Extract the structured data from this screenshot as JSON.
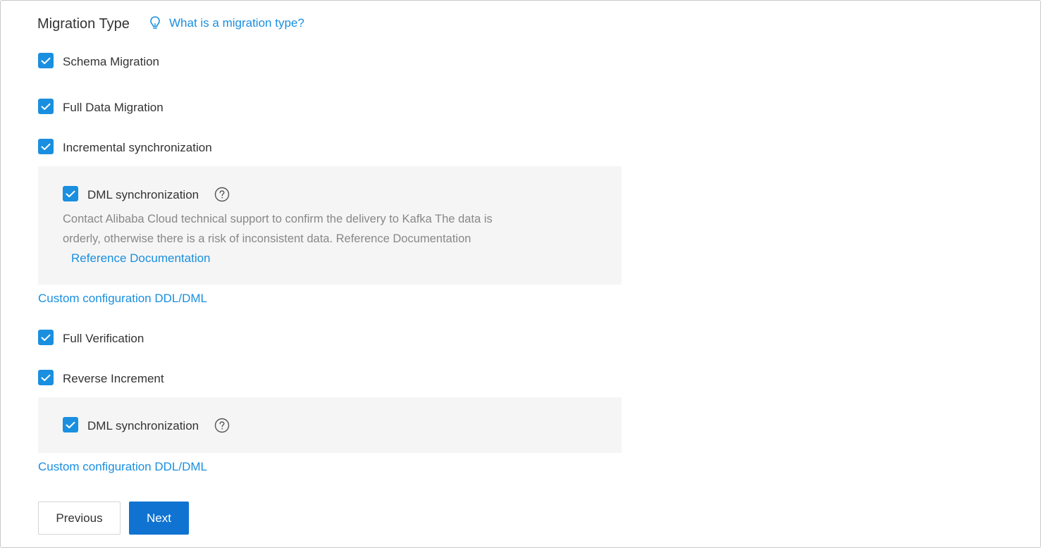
{
  "section": {
    "title": "Migration Type",
    "help_link": "What is a migration type?",
    "help_icon": "lightbulb-icon"
  },
  "options": {
    "schema_migration": {
      "label": "Schema Migration",
      "checked": true
    },
    "full_data_migration": {
      "label": "Full Data Migration",
      "checked": true
    },
    "incremental_sync": {
      "label": "Incremental synchronization",
      "checked": true,
      "sub": {
        "dml_label": "DML synchronization",
        "dml_checked": true,
        "help_icon": "question-circle-icon",
        "note_line1": "Contact Alibaba Cloud technical support to confirm the delivery to Kafka The data is",
        "note_line2": "orderly, otherwise there is a risk of inconsistent data. Reference Documentation",
        "note_link": "Reference Documentation"
      },
      "custom_config_link": "Custom configuration DDL/DML"
    },
    "full_verification": {
      "label": "Full Verification",
      "checked": true
    },
    "reverse_increment": {
      "label": "Reverse Increment",
      "checked": true,
      "sub": {
        "dml_label": "DML synchronization",
        "dml_checked": true,
        "help_icon": "question-circle-icon"
      },
      "custom_config_link": "Custom configuration DDL/DML"
    }
  },
  "footer": {
    "previous_label": "Previous",
    "next_label": "Next"
  },
  "colors": {
    "accent": "#1a8fe0",
    "primary_button": "#1073d1",
    "panel_bg": "#f5f5f5",
    "muted_text": "#888888"
  }
}
